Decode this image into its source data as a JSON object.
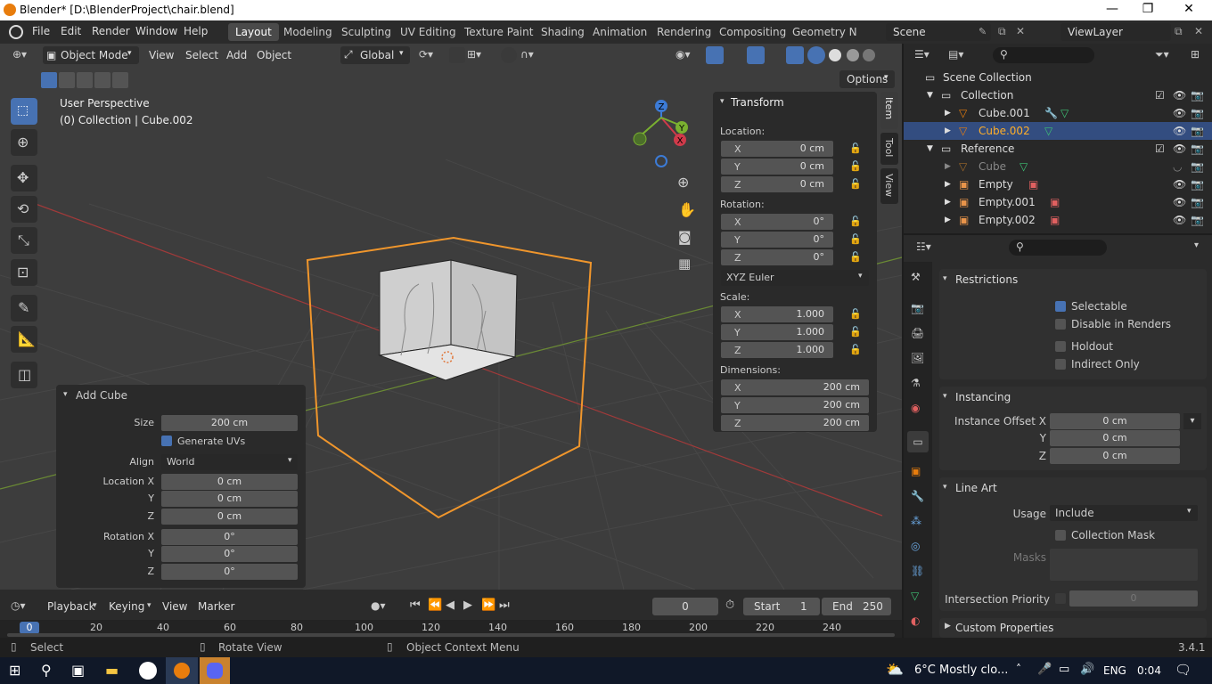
{
  "window": {
    "title": "Blender* [D:\\BlenderProject\\chair.blend]"
  },
  "menubar": {
    "items": [
      "File",
      "Edit",
      "Render",
      "Window",
      "Help"
    ]
  },
  "workspaces": [
    "Layout",
    "Modeling",
    "Sculpting",
    "UV Editing",
    "Texture Paint",
    "Shading",
    "Animation",
    "Rendering",
    "Compositing",
    "Geometry Nc"
  ],
  "scene": {
    "name": "Scene",
    "view_layer": "ViewLayer"
  },
  "viewport": {
    "mode": "Object Mode",
    "menus": [
      "View",
      "Select",
      "Add",
      "Object"
    ],
    "orientation": "Global",
    "options": "Options",
    "perspective": "User Perspective",
    "collection_info": "(0) Collection | Cube.002",
    "gizmo": {
      "x": "X",
      "y": "Y",
      "z": "Z"
    }
  },
  "sidebar_tabs": [
    "Item",
    "Tool",
    "View"
  ],
  "transform": {
    "title": "Transform",
    "location_label": "Location:",
    "location": [
      {
        "a": "X",
        "v": "0 cm"
      },
      {
        "a": "Y",
        "v": "0 cm"
      },
      {
        "a": "Z",
        "v": "0 cm"
      }
    ],
    "rotation_label": "Rotation:",
    "rotation": [
      {
        "a": "X",
        "v": "0°"
      },
      {
        "a": "Y",
        "v": "0°"
      },
      {
        "a": "Z",
        "v": "0°"
      }
    ],
    "rotation_mode": "XYZ Euler",
    "scale_label": "Scale:",
    "scale": [
      {
        "a": "X",
        "v": "1.000"
      },
      {
        "a": "Y",
        "v": "1.000"
      },
      {
        "a": "Z",
        "v": "1.000"
      }
    ],
    "dimensions_label": "Dimensions:",
    "dimensions": [
      {
        "a": "X",
        "v": "200 cm"
      },
      {
        "a": "Y",
        "v": "200 cm"
      },
      {
        "a": "Z",
        "v": "200 cm"
      }
    ]
  },
  "add_cube": {
    "title": "Add Cube",
    "size_label": "Size",
    "size": "200 cm",
    "generate_uvs": "Generate UVs",
    "align_label": "Align",
    "align": "World",
    "loc_x_label": "Location X",
    "y_label": "Y",
    "z_label": "Z",
    "loc": [
      "0 cm",
      "0 cm",
      "0 cm"
    ],
    "rot_x_label": "Rotation X",
    "rot": [
      "0°",
      "0°",
      "0°"
    ]
  },
  "outliner": {
    "root": "Scene Collection",
    "rows": [
      {
        "name": "Collection",
        "indent": 0
      },
      {
        "name": "Cube.001",
        "indent": 1
      },
      {
        "name": "Cube.002",
        "indent": 1
      },
      {
        "name": "Reference",
        "indent": 0
      },
      {
        "name": "Cube",
        "indent": 1
      },
      {
        "name": "Empty",
        "indent": 1
      },
      {
        "name": "Empty.001",
        "indent": 1
      },
      {
        "name": "Empty.002",
        "indent": 1
      }
    ]
  },
  "properties": {
    "restrictions": {
      "title": "Restrictions",
      "selectable": "Selectable",
      "disable_renders": "Disable in Renders",
      "holdout": "Holdout",
      "indirect_only": "Indirect Only"
    },
    "instancing": {
      "title": "Instancing",
      "offset_x_label": "Instance Offset X",
      "y_label": "Y",
      "z_label": "Z",
      "values": [
        "0 cm",
        "0 cm",
        "0 cm"
      ]
    },
    "line_art": {
      "title": "Line Art",
      "usage_label": "Usage",
      "usage": "Include",
      "collection_mask": "Collection Mask",
      "masks_label": "Masks",
      "intersection_label": "Intersection Priority",
      "intersection_value": "0"
    },
    "custom": {
      "title": "Custom Properties"
    }
  },
  "timeline": {
    "menus": [
      "Playback",
      "Keying",
      "View",
      "Marker"
    ],
    "current_frame": "0",
    "start_label": "Start",
    "start": "1",
    "end_label": "End",
    "end": "250",
    "ticks": [
      "0",
      "20",
      "40",
      "60",
      "80",
      "100",
      "120",
      "140",
      "160",
      "180",
      "200",
      "220",
      "240"
    ]
  },
  "status": {
    "select": "Select",
    "rotate": "Rotate View",
    "context": "Object Context Menu",
    "version": "3.4.1"
  },
  "taskbar": {
    "weather": "6°C  Mostly clo...",
    "lang": "ENG",
    "time": "0:04"
  },
  "colors": {
    "accent": "#e87d0d",
    "selection": "#334d80",
    "blue": "#4772b3"
  }
}
